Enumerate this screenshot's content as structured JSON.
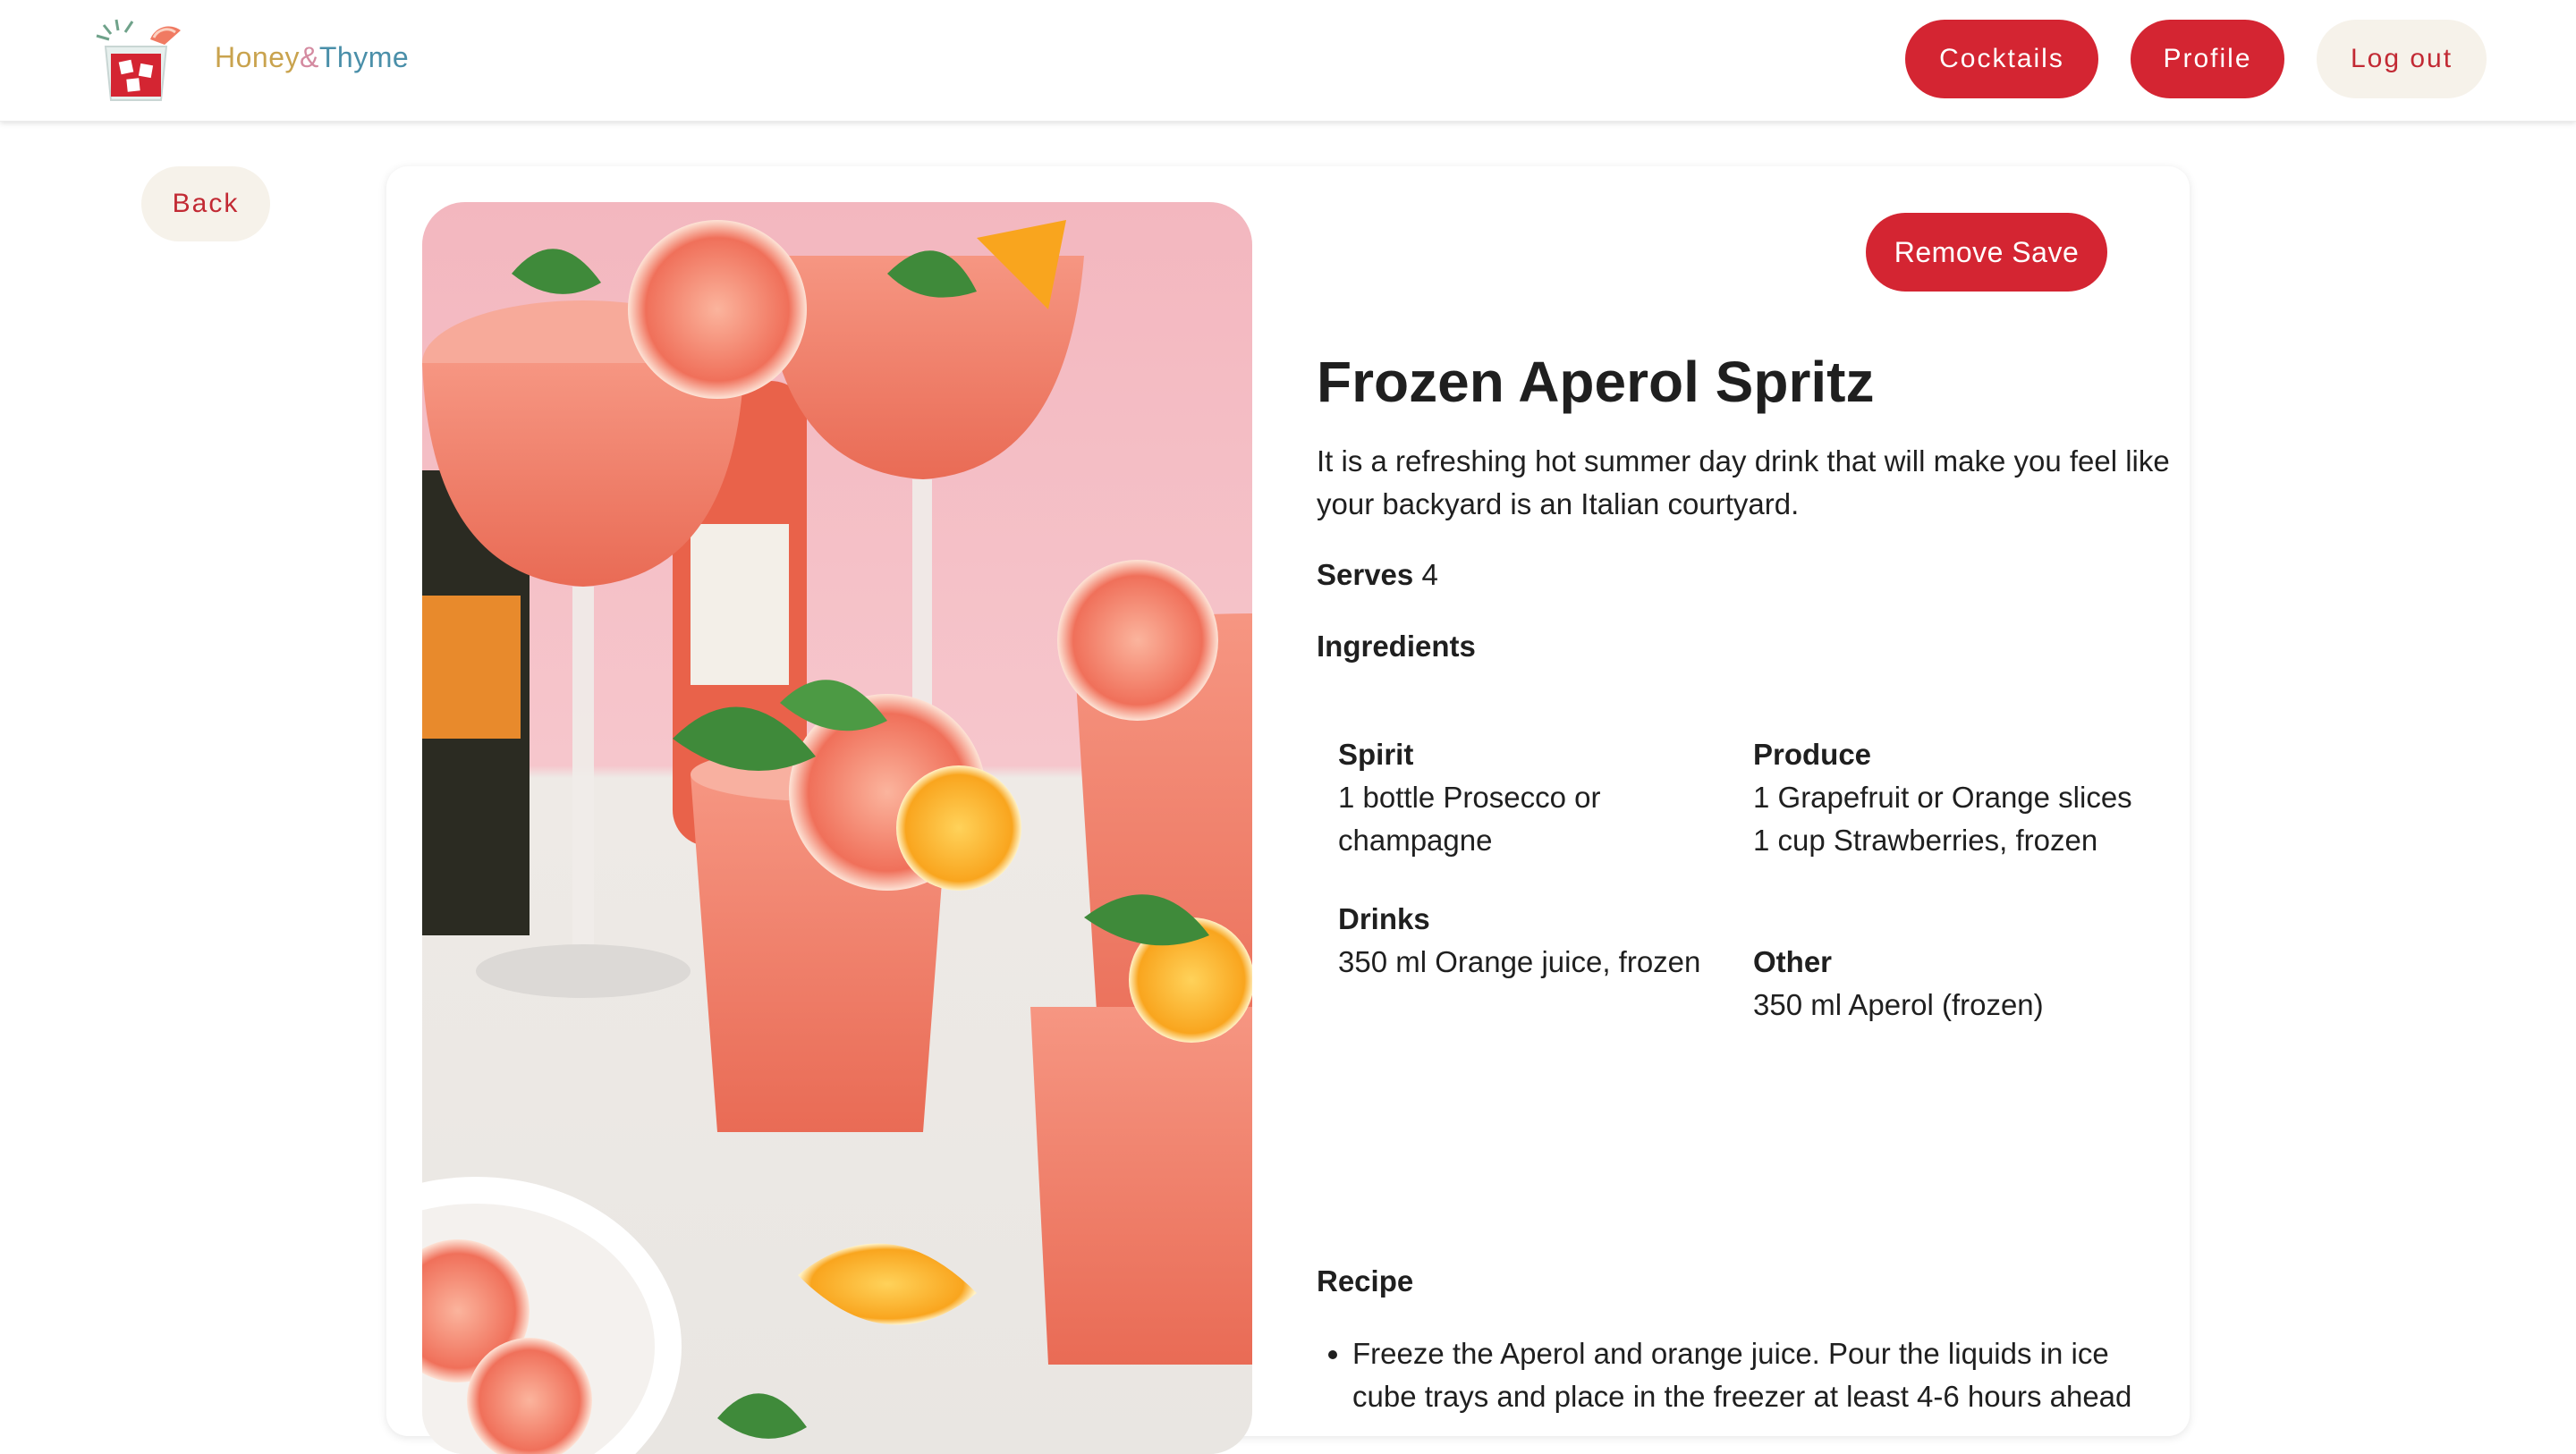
{
  "brand": {
    "part1": "Honey",
    "part2": "&",
    "part3": "Thyme"
  },
  "nav": {
    "cocktails": "Cocktails",
    "profile": "Profile",
    "logout": "Log out"
  },
  "back_label": "Back",
  "remove_save_label": "Remove Save",
  "drink": {
    "title": "Frozen Aperol Spritz",
    "description": "It is a refreshing hot summer day drink that will make you feel like your backyard is an Italian courtyard.",
    "serves_label": "Serves",
    "serves_value": "4",
    "ingredients_heading": "Ingredients",
    "groups": {
      "spirit": {
        "title": "Spirit",
        "items": [
          "1 bottle Prosecco or champagne"
        ]
      },
      "drinks": {
        "title": "Drinks",
        "items": [
          "350 ml Orange juice, frozen"
        ]
      },
      "produce": {
        "title": "Produce",
        "items": [
          "1 Grapefruit or Orange slices",
          "1 cup Strawberries, frozen"
        ]
      },
      "other": {
        "title": "Other",
        "items": [
          "350 ml Aperol (frozen)"
        ]
      }
    },
    "recipe_heading": "Recipe",
    "recipe_steps": [
      "Freeze the Aperol and orange juice. Pour the liquids in ice cube trays and place in the freezer at least 4-6 hours ahead"
    ]
  },
  "colors": {
    "accent_red": "#d42532",
    "cream": "#f6f2ea",
    "brand_gold": "#c9a34e",
    "brand_pink": "#d48aa0",
    "brand_teal": "#4a8fa9"
  },
  "icons": {
    "logo": "cocktail-glass-logo-icon",
    "photo": "frozen-spritz-photo"
  }
}
